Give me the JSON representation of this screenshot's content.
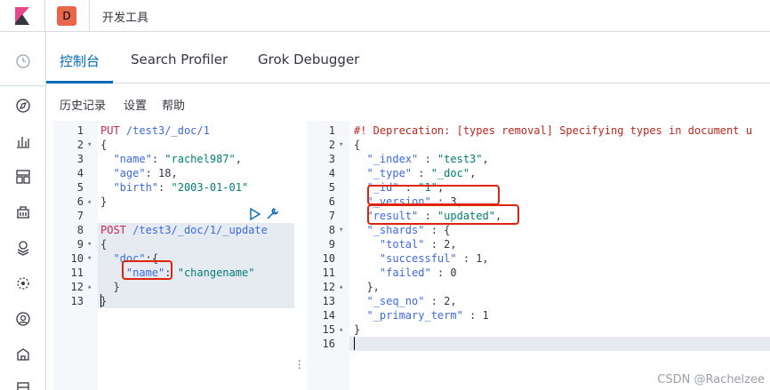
{
  "app": {
    "space_letter": "D",
    "breadcrumb": "开发工具"
  },
  "tabs": [
    {
      "label": "控制台",
      "active": true
    },
    {
      "label": "Search Profiler",
      "active": false
    },
    {
      "label": "Grok Debugger",
      "active": false
    }
  ],
  "menu": {
    "history": "历史记录",
    "settings": "设置",
    "help": "帮助"
  },
  "request_lines": [
    "PUT /test3/_doc/1",
    "{",
    "  \"name\": \"rachel987\",",
    "  \"age\": 18,",
    "  \"birth\": \"2003-01-01\"",
    "}",
    "",
    "POST /test3/_doc/1/_update",
    "{",
    "  \"doc\":{",
    "    \"name\": \"changename\"",
    "  }",
    "}"
  ],
  "response_lines": [
    "#! Deprecation: [types removal] Specifying types in document u",
    "{",
    "  \"_index\" : \"test3\",",
    "  \"_type\" : \"_doc\",",
    "  \"_id\" : \"1\",",
    "  \"_version\" : 3,",
    "  \"result\" : \"updated\",",
    "  \"_shards\" : {",
    "    \"total\" : 2,",
    "    \"successful\" : 1,",
    "    \"failed\" : 0",
    "  },",
    "  \"_seq_no\" : 2,",
    "  \"_primary_term\" : 1",
    "}",
    ""
  ],
  "watermark": "CSDN @Rachelzee",
  "colors": {
    "accent": "#006bb8",
    "annotation": "#e0230c",
    "method": "#c7254e"
  },
  "icons": {
    "nav": [
      "clock-icon",
      "compass-icon",
      "bar-chart-icon",
      "dashboard-icon",
      "canvas-icon",
      "maps-icon",
      "ml-icon",
      "metrics-icon",
      "logs-icon",
      "apm-icon"
    ],
    "editor_actions": [
      "play-icon",
      "wrench-icon"
    ]
  }
}
